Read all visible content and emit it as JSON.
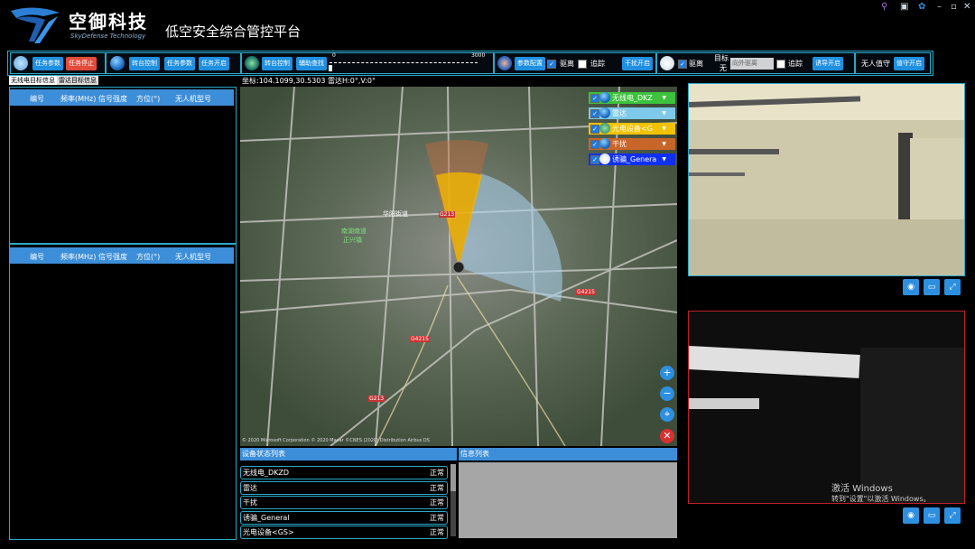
{
  "header": {
    "logo_cn": "空御科技",
    "logo_en": "SkyDefense Technology",
    "title": "低空安全综合管控平台",
    "window_controls": [
      "key-icon",
      "screen-icon",
      "gear-icon",
      "minimize-icon",
      "maximize-icon",
      "close-icon"
    ]
  },
  "toolbar": {
    "g1": {
      "task_params": "任务参数",
      "task_stop": "任务停止"
    },
    "g2": {
      "turret_control": "转台控制",
      "task_params": "任务参数",
      "task_start": "任务开启"
    },
    "g3": {
      "turret_control": "转台控制",
      "aux_search": "辅助查找",
      "slider_min": "0",
      "slider_max": "3000",
      "slider_value": 0
    },
    "g4": {
      "param_config": "参数配置",
      "drive_away": "驱离",
      "track": "追踪",
      "jam_start": "干扰开启"
    },
    "g5": {
      "drive_away": "驱离",
      "target_label": "目标",
      "target_value": "无",
      "direction_placeholder": "向外驱离",
      "track": "追踪",
      "lure_start": "诱导开启"
    },
    "g6": {
      "uav_guard": "无人值守",
      "guard_start": "值守开启"
    }
  },
  "left": {
    "tabs": [
      "无线电目标信息",
      "雷达目标信息"
    ],
    "columns": [
      "编号",
      "频率(MHz)",
      "信号强度",
      "方位(°)",
      "无人机型号"
    ]
  },
  "map": {
    "coord_text": "坐标:104.1099,30.5303  雷达H:0°,V:0°",
    "copyright": "© 2020 Microsoft Corporation © 2020 Maxar ©CNES (2020) Distribution Airbus DS",
    "places": [
      "华阳街道",
      "南湖南道",
      "正兴镇",
      "G4215",
      "G4215",
      "G213",
      "G213"
    ],
    "legend": [
      {
        "label": "无线电_DKZ",
        "color": "#3cc23c",
        "icon": "radio-icon"
      },
      {
        "label": "雷达",
        "color": "#7ec8e8",
        "icon": "radar-icon"
      },
      {
        "label": "光电设备<G",
        "color": "#f2c200",
        "icon": "camera-icon"
      },
      {
        "label": "干扰",
        "color": "#c8662a",
        "icon": "jammer-icon"
      },
      {
        "label": "诱骗_Genera",
        "color": "#1030f0",
        "icon": "spoof-icon"
      }
    ],
    "controls": [
      "zoom-in-icon",
      "zoom-out-icon",
      "locate-icon",
      "close-icon"
    ]
  },
  "device_status": {
    "title": "设备状态列表",
    "rows": [
      {
        "name": "无线电_DKZD",
        "status": "正常"
      },
      {
        "name": "雷达",
        "status": "正常"
      },
      {
        "name": "干扰",
        "status": "正常"
      },
      {
        "name": "诱骗_General",
        "status": "正常"
      },
      {
        "name": "光电设备<GS>",
        "status": "正常"
      }
    ]
  },
  "messages": {
    "title": "信息列表"
  },
  "video": {
    "watermark_title": "激活 Windows",
    "watermark_sub": "转到\"设置\"以激活 Windows。"
  },
  "colors": {
    "accent": "#2aa9c9",
    "button": "#1f8fe0",
    "stop": "#e24b3b",
    "header_row": "#3d8ed8"
  }
}
